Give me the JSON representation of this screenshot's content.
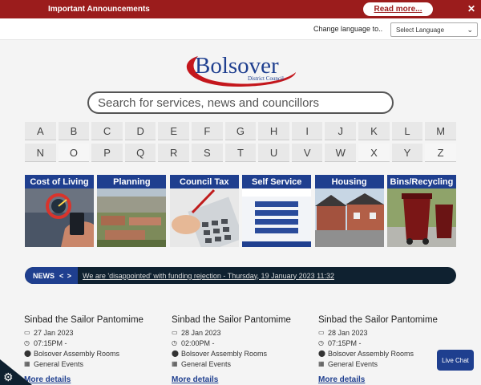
{
  "announcement": {
    "title": "Important Announcements",
    "read_more": "Read more...",
    "close_icon": "✕"
  },
  "language": {
    "label": "Change language to..",
    "selected": "Select Language"
  },
  "logo": {
    "name": "Bolsover",
    "subtitle": "District Council"
  },
  "search": {
    "placeholder": "Search for services, news and councillors"
  },
  "az_rows": [
    [
      "A",
      "B",
      "C",
      "D",
      "E",
      "F",
      "G",
      "H",
      "I",
      "J",
      "K",
      "L",
      "M"
    ],
    [
      "N",
      "O",
      "P",
      "Q",
      "R",
      "S",
      "T",
      "U",
      "V",
      "W",
      "X",
      "Y",
      "Z"
    ]
  ],
  "tiles": [
    {
      "label": "Cost of Living"
    },
    {
      "label": "Planning"
    },
    {
      "label": "Council Tax"
    },
    {
      "label": "Self Service"
    },
    {
      "label": "Housing"
    },
    {
      "label": "Bins/Recycling"
    }
  ],
  "news": {
    "tag": "NEWS",
    "arrows": "< >",
    "headline": "We are 'disappointed' with funding rejection - Thursday, 19 January 2023 11:32"
  },
  "events": [
    {
      "title": "Sinbad the Sailor Pantomime",
      "date": "27 Jan 2023",
      "time": "07:15PM -",
      "venue": "Bolsover Assembly Rooms",
      "category": "General Events",
      "more": "More details"
    },
    {
      "title": "Sinbad the Sailor Pantomime",
      "date": "28 Jan 2023",
      "time": "02:00PM -",
      "venue": "Bolsover Assembly Rooms",
      "category": "General Events",
      "more": "More details"
    },
    {
      "title": "Sinbad the Sailor Pantomime",
      "date": "28 Jan 2023",
      "time": "07:15PM -",
      "venue": "Bolsover Assembly Rooms",
      "category": "General Events",
      "more": "More details"
    }
  ],
  "live_chat": "Live Chat",
  "colors": {
    "announcement_bg": "#9b1c1c",
    "brand_blue": "#1f3f8f",
    "news_bg": "#0f2130"
  },
  "icons": {
    "calendar": "calendar-icon",
    "clock": "clock-icon",
    "location": "map-pin-icon",
    "category": "grid-icon",
    "cookie": "gear-icon"
  }
}
